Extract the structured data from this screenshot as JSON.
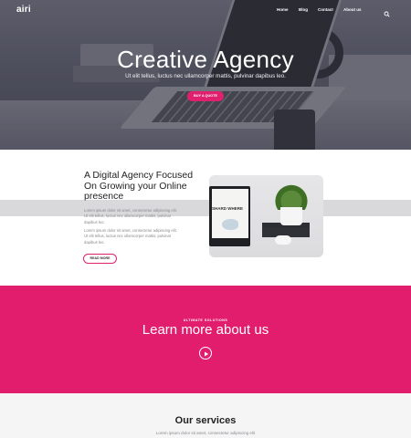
{
  "header": {
    "logo": "airi",
    "nav": [
      {
        "label": "Home"
      },
      {
        "label": "Blog"
      },
      {
        "label": "Contact"
      },
      {
        "label": "About us"
      }
    ],
    "search_icon": "search-icon"
  },
  "hero": {
    "title": "Creative Agency",
    "subtitle": "Ut elit tellus, luctus nec ullamcorper mattis, pulvinar dapibus leo.",
    "button": "BUY A QUOTE"
  },
  "about": {
    "title": "A Digital Agency Focused On Growing your Online presence",
    "paragraph1": "Lorem ipsum dolor sit amet, consectetur adipiscing elit. Ut elit tellus, luctus nec ullamcorper mattis, pulvinar dapibus leo.",
    "paragraph2": "Lorem ipsum dolor sit amet, consectetur adipiscing elit. Ut elit tellus, luctus nec ullamcorper mattis, pulvinar dapibus leo.",
    "button": "READ MORE",
    "image_text": "SHARD WHERE"
  },
  "cta": {
    "kicker": "ULTIMATE SOLUTIONS",
    "title": "Learn more about us",
    "play_icon": "play-icon"
  },
  "services": {
    "title": "Our services",
    "subtitle": "Lorem ipsum dolor sit amet, consectetur adipiscing elit"
  },
  "colors": {
    "accent": "#e31d6e",
    "hero_overlay": "#585a66",
    "services_bg": "#f5f5f6"
  }
}
